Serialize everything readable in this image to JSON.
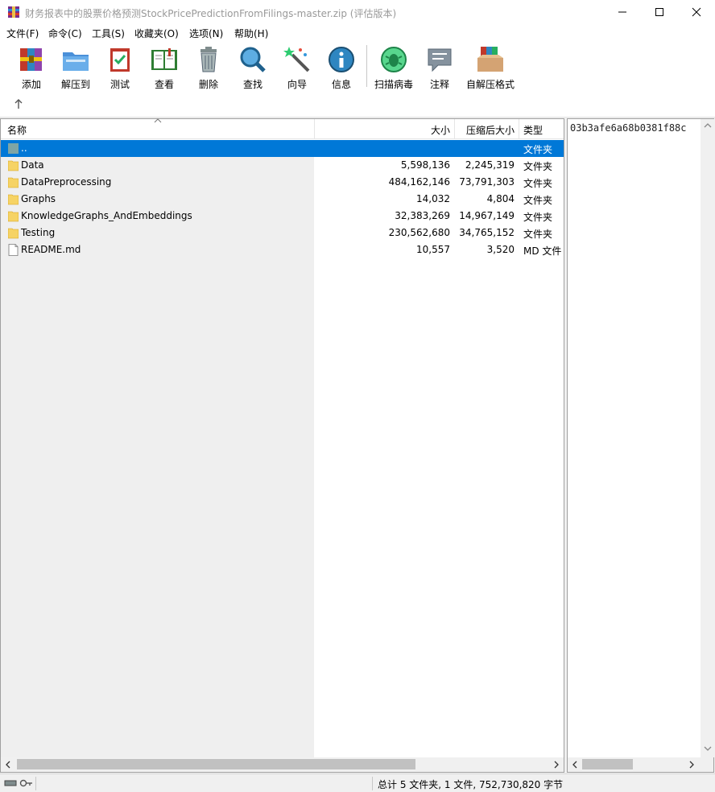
{
  "window": {
    "title": "财务报表中的股票价格预测StockPricePredictionFromFilings-master.zip (评估版本)"
  },
  "menu": [
    {
      "label": "文件(F)"
    },
    {
      "label": "命令(C)"
    },
    {
      "label": "工具(S)"
    },
    {
      "label": "收藏夹(O)"
    },
    {
      "label": "选项(N)"
    },
    {
      "label": "帮助(H)"
    }
  ],
  "toolbar": [
    {
      "label": "添加",
      "icon": "add-archive-icon"
    },
    {
      "label": "解压到",
      "icon": "extract-folder-icon"
    },
    {
      "label": "测试",
      "icon": "test-clipboard-icon"
    },
    {
      "label": "查看",
      "icon": "view-book-icon"
    },
    {
      "label": "删除",
      "icon": "trash-icon"
    },
    {
      "label": "查找",
      "icon": "magnifier-icon"
    },
    {
      "label": "向导",
      "icon": "wizard-wand-icon"
    },
    {
      "label": "信息",
      "icon": "info-icon"
    },
    {
      "label": "扫描病毒",
      "icon": "virus-scan-icon"
    },
    {
      "label": "注释",
      "icon": "comment-icon"
    },
    {
      "label": "自解压格式",
      "icon": "sfx-box-icon"
    }
  ],
  "columns": {
    "name": "名称",
    "size": "大小",
    "packed": "压缩后大小",
    "type": "类型"
  },
  "rows": [
    {
      "name": "..",
      "size": "",
      "packed": "",
      "type": "文件夹",
      "icon": "parent-folder-icon",
      "selected": true
    },
    {
      "name": "Data",
      "size": "5,598,136",
      "packed": "2,245,319",
      "type": "文件夹",
      "icon": "folder-icon"
    },
    {
      "name": "DataPreprocessing",
      "size": "484,162,146",
      "packed": "73,791,303",
      "type": "文件夹",
      "icon": "folder-icon"
    },
    {
      "name": "Graphs",
      "size": "14,032",
      "packed": "4,804",
      "type": "文件夹",
      "icon": "folder-icon"
    },
    {
      "name": "KnowledgeGraphs_AndEmbeddings",
      "size": "32,383,269",
      "packed": "14,967,149",
      "type": "文件夹",
      "icon": "folder-icon"
    },
    {
      "name": "Testing",
      "size": "230,562,680",
      "packed": "34,765,152",
      "type": "文件夹",
      "icon": "folder-icon"
    },
    {
      "name": "README.md",
      "size": "10,557",
      "packed": "3,520",
      "type": "MD 文件",
      "icon": "file-icon"
    }
  ],
  "comment": {
    "text": "03b3afe6a68b0381f88c"
  },
  "status": {
    "summary": "总计 5 文件夹, 1 文件, 752,730,820 字节"
  },
  "colors": {
    "selection": "#0078d7",
    "folder": "#f6d365",
    "accent": "#0078d7"
  }
}
